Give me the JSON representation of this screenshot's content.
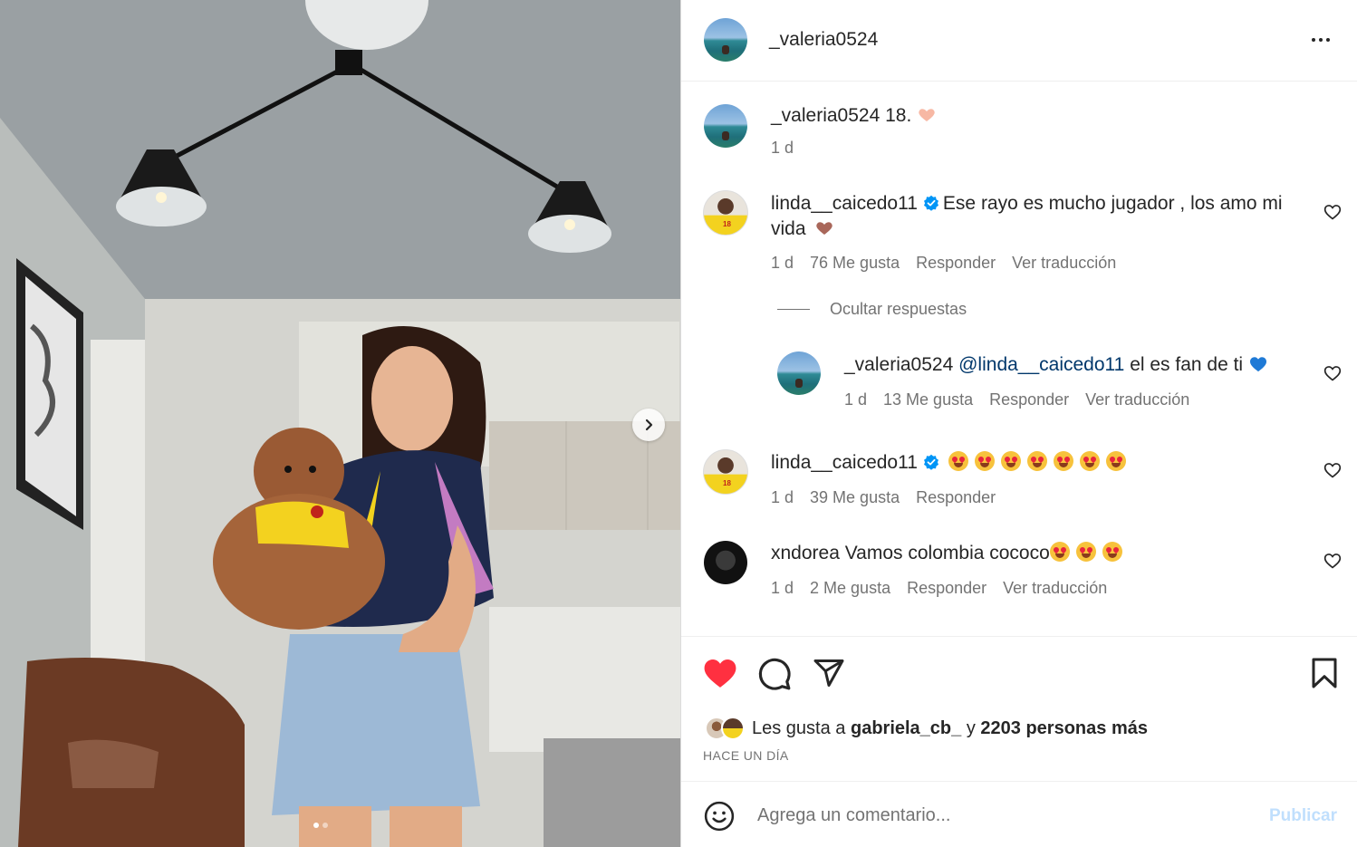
{
  "post": {
    "author": "_valeria0524",
    "more_icon": "more-horizontal-icon"
  },
  "caption": {
    "username": "_valeria0524",
    "text": "18.",
    "time": "1 d"
  },
  "comments": [
    {
      "username": "linda__caicedo11",
      "verified": true,
      "text": "Ese rayo es mucho jugador , los amo mi",
      "text_line2": "vida",
      "time": "1 d",
      "likes": "76 Me gusta",
      "reply": "Responder",
      "translate": "Ver traducción"
    },
    {
      "username": "linda__caicedo11",
      "verified": true,
      "text": "",
      "time": "1 d",
      "likes": "39 Me gusta",
      "reply": "Responder"
    },
    {
      "username": "xndorea",
      "text": "Vamos colombia cococo",
      "time": "1 d",
      "likes": "2 Me gusta",
      "reply": "Responder",
      "translate": "Ver traducción"
    }
  ],
  "hide_replies": "Ocultar respuestas",
  "reply": {
    "username": "_valeria0524",
    "mention": "@linda__caicedo11",
    "text": "el es fan de ti",
    "time": "1 d",
    "likes": "13 Me gusta",
    "reply": "Responder",
    "translate": "Ver traducción"
  },
  "likes_summary": {
    "prefix": "Les gusta a",
    "user": "gabriela_cb_",
    "middle": "y",
    "others": "2203 personas más"
  },
  "time_ago": "HACE UN DÍA",
  "comment_input": {
    "placeholder": "Agrega un comentario..."
  },
  "publish_label": "Publicar",
  "colors": {
    "like_red": "#ff3040",
    "verified_blue": "#0095f6",
    "publish_disabled": "#c0dffd",
    "secondary_text": "#737373"
  }
}
